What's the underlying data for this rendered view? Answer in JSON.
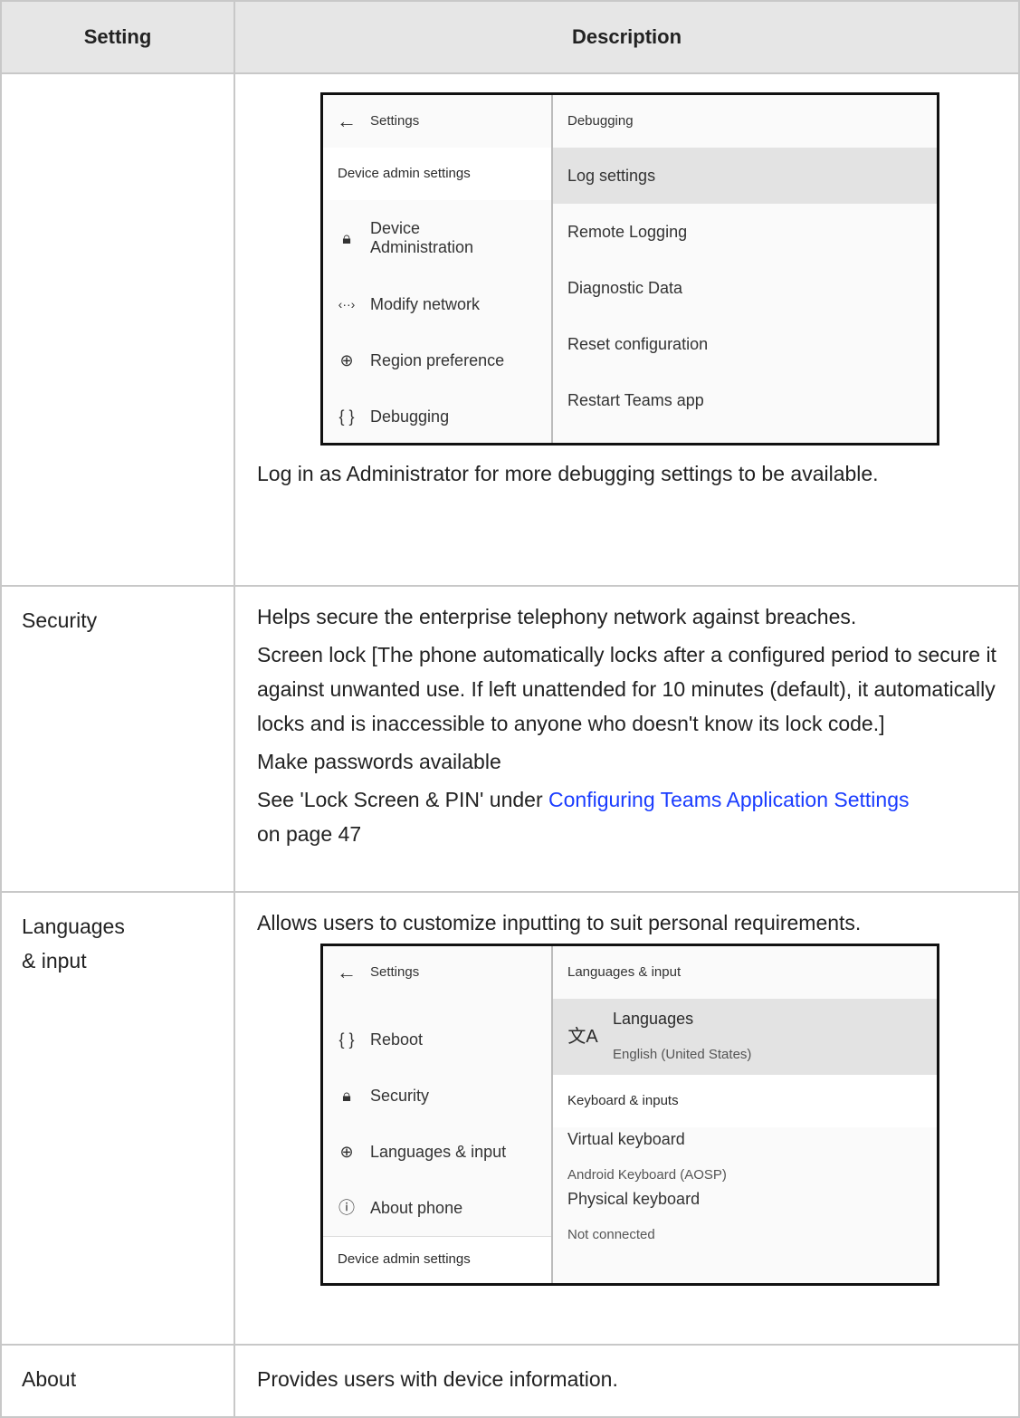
{
  "table": {
    "header": {
      "setting": "Setting",
      "description": "Description"
    }
  },
  "row_debugging": {
    "screenshot": {
      "left_title": "Settings",
      "right_title": "Debugging",
      "section_label": "Device admin settings",
      "nav_items": [
        {
          "label_line1": "Device",
          "label_line2": "Administration",
          "icon": "lock-icon"
        },
        {
          "label": "Modify network",
          "icon": "network-arrows-icon"
        },
        {
          "label": "Region preference",
          "icon": "globe-icon"
        },
        {
          "label": "Debugging",
          "icon": "braces-icon"
        }
      ],
      "right_items": [
        "Log settings",
        "Remote Logging",
        "Diagnostic Data",
        "Reset configuration",
        "Restart Teams app"
      ]
    },
    "note": "Log in as Administrator for more debugging settings to be available."
  },
  "row_security": {
    "setting": "Security",
    "lines": [
      "Helps secure the enterprise telephony network against breaches.",
      "Screen lock [The phone automatically locks after a configured period to secure it against unwanted use. If left unattended for 10 minutes (default), it automatically locks and is inaccessible to anyone who doesn't know its lock code.]",
      "Make passwords available"
    ],
    "see_prefix": "See 'Lock Screen & PIN' under ",
    "link_text": "Configuring Teams Application Settings",
    "see_suffix": "on page 47"
  },
  "row_languages": {
    "setting_line1": "Languages",
    "setting_line2": "& input",
    "description": "Allows users to customize inputting to suit personal requirements.",
    "screenshot": {
      "left_title": "Settings",
      "right_title": "Languages & input",
      "nav_items": [
        {
          "label": "Reboot",
          "icon": "braces-icon"
        },
        {
          "label": "Security",
          "icon": "lock-icon"
        },
        {
          "label": "Languages & input",
          "icon": "globe-icon"
        },
        {
          "label": "About phone",
          "icon": "info-icon"
        }
      ],
      "section_label": "Device admin settings",
      "languages_title": "Languages",
      "languages_sub": "English (United States)",
      "keyboard_header": "Keyboard & inputs",
      "virtual_title": "Virtual keyboard",
      "virtual_sub": "Android Keyboard (AOSP)",
      "physical_title": "Physical keyboard",
      "physical_sub": "Not connected"
    }
  },
  "row_about": {
    "setting": "About",
    "description": "Provides users with device information."
  }
}
